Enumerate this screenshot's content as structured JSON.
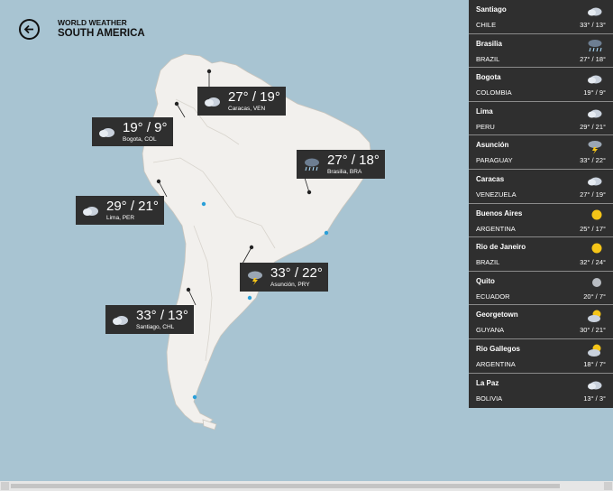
{
  "header": {
    "app_name": "WORLD WEATHER",
    "region": "SOUTH AMERICA"
  },
  "callouts": [
    {
      "id": "caracas",
      "temps": "27° / 19°",
      "city": "Caracas, VEN",
      "icon": "cloudy-icon"
    },
    {
      "id": "bogota",
      "temps": "19° / 9°",
      "city": "Bogota, COL",
      "icon": "cloudy-icon"
    },
    {
      "id": "brasilia",
      "temps": "27° / 18°",
      "city": "Brasilia, BRA",
      "icon": "rain-icon"
    },
    {
      "id": "lima",
      "temps": "29° / 21°",
      "city": "Lima, PER",
      "icon": "cloudy-icon"
    },
    {
      "id": "asuncion",
      "temps": "33° / 22°",
      "city": "Asunción, PRY",
      "icon": "thunderstorm-icon"
    },
    {
      "id": "santiago",
      "temps": "33° / 13°",
      "city": "Santiago, CHL",
      "icon": "cloudy-icon"
    }
  ],
  "sidebar": {
    "items": [
      {
        "city": "Santiago",
        "country": "CHILE",
        "temps": "33° / 13°",
        "icon": "cloudy-icon"
      },
      {
        "city": "Brasilia",
        "country": "BRAZIL",
        "temps": "27° / 18°",
        "icon": "rain-icon"
      },
      {
        "city": "Bogota",
        "country": "COLOMBIA",
        "temps": "19° / 9°",
        "icon": "cloudy-icon"
      },
      {
        "city": "Lima",
        "country": "PERU",
        "temps": "29° / 21°",
        "icon": "cloudy-icon"
      },
      {
        "city": "Asunción",
        "country": "PARAGUAY",
        "temps": "33° / 22°",
        "icon": "thunderstorm-icon"
      },
      {
        "city": "Caracas",
        "country": "VENEZUELA",
        "temps": "27° / 19°",
        "icon": "cloudy-icon"
      },
      {
        "city": "Buenos Aires",
        "country": "ARGENTINA",
        "temps": "25° / 17°",
        "icon": "sun-icon"
      },
      {
        "city": "Rio de Janeiro",
        "country": "BRAZIL",
        "temps": "32° / 24°",
        "icon": "sun-icon"
      },
      {
        "city": "Quito",
        "country": "ECUADOR",
        "temps": "20° / 7°",
        "icon": "moon-icon"
      },
      {
        "city": "Georgetown",
        "country": "GUYANA",
        "temps": "30° / 21°",
        "icon": "partly-cloudy-icon"
      },
      {
        "city": "Rio Gallegos",
        "country": "ARGENTINA",
        "temps": "18° / 7°",
        "icon": "partly-cloudy-icon"
      },
      {
        "city": "La Paz",
        "country": "BOLIVIA",
        "temps": "13° / 3°",
        "icon": "cloudy-icon"
      }
    ]
  },
  "colors": {
    "ocean": "#a8c4d2",
    "land": "#f2f0ed",
    "panel": "#2f2f2f",
    "marker": "#2a9fd8",
    "sun": "#f5c518"
  }
}
